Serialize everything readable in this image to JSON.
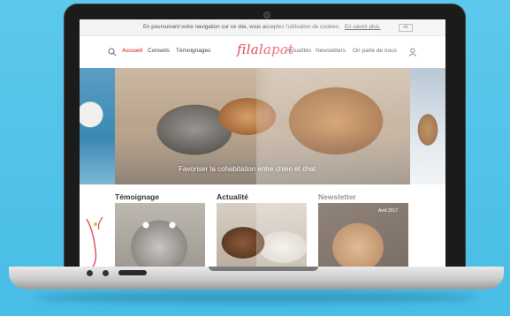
{
  "cookie_bar": {
    "text": "En poursuivant votre navigation sur ce site, vous acceptez l'utilisation de cookies.",
    "link": "En savoir plus.",
    "ok": "ok"
  },
  "nav": {
    "items_left": [
      "Accueil",
      "Conseils",
      "Témoignages"
    ],
    "logo": "filalapat",
    "items_right": [
      "Actualités",
      "Newsletters",
      "On parle de nous"
    ]
  },
  "hero": {
    "caption": "Favoriser la cohabitation entre chien et chat"
  },
  "sections": {
    "temoignage": "Témoignage",
    "actualite": "Actualité",
    "newsletter": "Newsletter",
    "newsletter_date": "Avril 2017"
  },
  "colors": {
    "accent": "#e2453f",
    "logo": "#e24a5a",
    "background": "#4cc0e8"
  },
  "icons": [
    "search-icon",
    "user-icon",
    "camera-icon"
  ]
}
